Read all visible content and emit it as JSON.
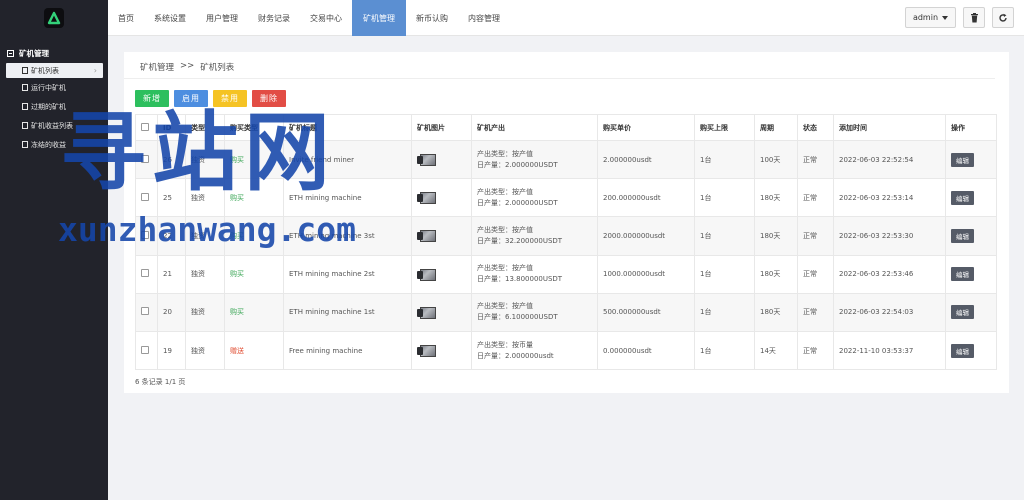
{
  "sidebar": {
    "group_title": "矿机管理",
    "items": [
      {
        "label": "矿机列表",
        "active": true
      },
      {
        "label": "运行中矿机",
        "active": false
      },
      {
        "label": "过期的矿机",
        "active": false
      },
      {
        "label": "矿机收益列表",
        "active": false
      },
      {
        "label": "冻结的收益",
        "active": false
      }
    ]
  },
  "topnav": {
    "tabs": [
      "首页",
      "系统设置",
      "用户管理",
      "财务记录",
      "交易中心",
      "矿机管理",
      "新币认购",
      "内容管理"
    ],
    "active_index": 5
  },
  "topright": {
    "admin_label": "admin"
  },
  "breadcrumb": {
    "parent": "矿机管理",
    "sep": ">>",
    "current": "矿机列表"
  },
  "actions": {
    "add": "新增",
    "enable": "启用",
    "disable": "禁用",
    "delete": "删除"
  },
  "table": {
    "headers": [
      "ID",
      "类型",
      "购买类型",
      "矿机标题",
      "矿机图片",
      "矿机产出",
      "购买单价",
      "购买上限",
      "周期",
      "状态",
      "添加时间",
      "操作"
    ],
    "rows": [
      {
        "id": "26",
        "type": "独资",
        "buy_type": "购买",
        "title": "Invite friend miner",
        "output_type": "产出类型：按产值",
        "output_day": "日产量：2.000000USDT",
        "price": "2.000000usdt",
        "limit": "1台",
        "cycle": "100天",
        "status": "正常",
        "time": "2022-06-03 22:52:54",
        "op": "编辑"
      },
      {
        "id": "25",
        "type": "独资",
        "buy_type": "购买",
        "title": "ETH mining machine",
        "output_type": "产出类型：按产值",
        "output_day": "日产量：2.000000USDT",
        "price": "200.000000usdt",
        "limit": "1台",
        "cycle": "180天",
        "status": "正常",
        "time": "2022-06-03 22:53:14",
        "op": "编辑"
      },
      {
        "id": "22",
        "type": "独资",
        "buy_type": "购买",
        "title": "ETH mining machine 3st",
        "output_type": "产出类型：按产值",
        "output_day": "日产量：32.200000USDT",
        "price": "2000.000000usdt",
        "limit": "1台",
        "cycle": "180天",
        "status": "正常",
        "time": "2022-06-03 22:53:30",
        "op": "编辑"
      },
      {
        "id": "21",
        "type": "独资",
        "buy_type": "购买",
        "title": "ETH mining machine 2st",
        "output_type": "产出类型：按产值",
        "output_day": "日产量：13.800000USDT",
        "price": "1000.000000usdt",
        "limit": "1台",
        "cycle": "180天",
        "status": "正常",
        "time": "2022-06-03 22:53:46",
        "op": "编辑"
      },
      {
        "id": "20",
        "type": "独资",
        "buy_type": "购买",
        "title": "ETH mining machine 1st",
        "output_type": "产出类型：按产值",
        "output_day": "日产量：6.100000USDT",
        "price": "500.000000usdt",
        "limit": "1台",
        "cycle": "180天",
        "status": "正常",
        "time": "2022-06-03 22:54:03",
        "op": "编辑"
      },
      {
        "id": "19",
        "type": "独资",
        "buy_type": "赠送",
        "title": "Free mining machine",
        "output_type": "产出类型：按币量",
        "output_day": "日产量：2.000000usdt",
        "price": "0.000000usdt",
        "limit": "1台",
        "cycle": "14天",
        "status": "正常",
        "time": "2022-11-10 03:53:37",
        "op": "编辑"
      }
    ]
  },
  "pager": "6 条记录 1/1 页",
  "watermark": {
    "big": "寻站网",
    "small": "xunzhanwang.com"
  },
  "colors": {
    "sidebar_bg": "#22232b",
    "tab_active": "#5b8fd2",
    "btn_add": "#2dbf5e",
    "btn_enable": "#4d8ee0",
    "btn_disable": "#f5c324",
    "btn_delete": "#e24d45",
    "logo_accent": "#33d17a"
  }
}
